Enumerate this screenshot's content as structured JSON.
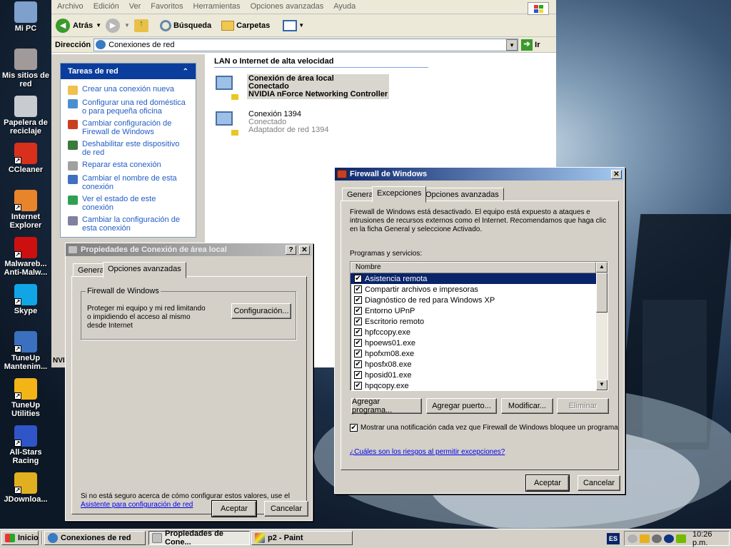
{
  "desktop": {
    "icons": [
      {
        "label": "Mi PC",
        "icon": "computer-icon",
        "color": "#7ea0cc",
        "shortcut": false
      },
      {
        "label": "Mis sitios de red",
        "icon": "network-places-icon",
        "color": "#a09a9a",
        "shortcut": false
      },
      {
        "label": "Papelera de reciclaje",
        "icon": "recycle-bin-icon",
        "color": "#c8ccd0",
        "shortcut": false
      },
      {
        "label": "CCleaner",
        "icon": "ccleaner-icon",
        "color": "#d8301c",
        "shortcut": true
      },
      {
        "label": "Internet Explorer",
        "icon": "firefox-icon",
        "color": "#e8842a",
        "shortcut": true
      },
      {
        "label": "Malwareb... Anti-Malw...",
        "icon": "malwarebytes-icon",
        "color": "#cc1010",
        "shortcut": true
      },
      {
        "label": "Skype",
        "icon": "skype-icon",
        "color": "#12a5e6",
        "shortcut": true
      },
      {
        "label": "TuneUp Mantenim...",
        "icon": "tuneup-maintenance-icon",
        "color": "#3b6fbf",
        "shortcut": true
      },
      {
        "label": "TuneUp Utilities",
        "icon": "tuneup-utilities-icon",
        "color": "#f2b417",
        "shortcut": true
      },
      {
        "label": "All-Stars Racing",
        "icon": "sonic-icon",
        "color": "#2f55c8",
        "shortcut": true
      },
      {
        "label": "JDownloa...",
        "icon": "jdownloader-icon",
        "color": "#e0b020",
        "shortcut": true
      }
    ]
  },
  "explorer": {
    "menu": [
      "Archivo",
      "Edición",
      "Ver",
      "Favoritos",
      "Herramientas",
      "Opciones avanzadas",
      "Ayuda"
    ],
    "toolbar": {
      "back": "Atrás",
      "search": "Búsqueda",
      "folders": "Carpetas"
    },
    "address": {
      "label": "Dirección",
      "value": "Conexiones de red",
      "go": "Ir"
    },
    "tasks": {
      "title": "Tareas de red",
      "items": [
        {
          "label": "Crear una conexión nueva",
          "icon": "new-connection-icon"
        },
        {
          "label": "Configurar una red doméstica o para pequeña oficina",
          "icon": "home-network-icon"
        },
        {
          "label": "Cambiar configuración de Firewall de Windows",
          "icon": "firewall-icon"
        },
        {
          "label": "Deshabilitar este dispositivo de red",
          "icon": "disable-device-icon"
        },
        {
          "label": "Reparar esta conexión",
          "icon": "repair-icon"
        },
        {
          "label": "Cambiar el nombre de esta conexión",
          "icon": "rename-icon"
        },
        {
          "label": "Ver el estado de este conexión",
          "icon": "status-icon"
        },
        {
          "label": "Cambiar la configuración de esta conexión",
          "icon": "settings-icon"
        }
      ]
    },
    "group_title": "LAN o Internet de alta velocidad",
    "connections": [
      {
        "name": "Conexión de área local",
        "status": "Conectado",
        "device": "NVIDIA nForce Networking Controller"
      },
      {
        "name": "Conexión 1394",
        "status": "Conectado",
        "device": "Adaptador de red 1394"
      }
    ],
    "status_fragment": "NVI"
  },
  "props": {
    "title": "Propiedades de Conexión de área local",
    "tabs": [
      "General",
      "Opciones avanzadas"
    ],
    "group_title": "Firewall de Windows",
    "group_text": "Proteger mi equipo y mi red limitando o impidiendo el acceso al mismo desde Internet",
    "config_button": "Configuración...",
    "footer_text": "Si no está seguro acerca de cómo configurar estos valores, use el",
    "footer_link": "Asistente para configuración de red",
    "ok": "Aceptar",
    "cancel": "Cancelar"
  },
  "firewall": {
    "title": "Firewall de Windows",
    "tabs": [
      "General",
      "Excepciones",
      "Opciones avanzadas"
    ],
    "info": "Firewall de Windows está desactivado. El equipo está expuesto a ataques e intrusiones de recursos externos como el Internet. Recomendamos que haga clic en la ficha General y seleccione Activado.",
    "list_label": "Programas y servicios:",
    "column": "Nombre",
    "programs": [
      "Asistencia remota",
      "Compartir archivos e impresoras",
      "Diagnóstico de red para Windows XP",
      "Entorno UPnP",
      "Escritorio remoto",
      "hpfccopy.exe",
      "hpoews01.exe",
      "hpofxm08.exe",
      "hposfx08.exe",
      "hposid01.exe",
      "hpqcopy.exe"
    ],
    "buttons": {
      "add_program": "Agregar programa...",
      "add_port": "Agregar puerto...",
      "modify": "Modificar...",
      "delete": "Eliminar"
    },
    "notify": "Mostrar una notificación cada vez que Firewall de Windows bloquee un programa",
    "risks_link": "¿Cuáles son los riesgos al permitir excepciones?",
    "ok": "Aceptar",
    "cancel": "Cancelar"
  },
  "taskbar": {
    "start": "Inicio",
    "items": [
      "Conexiones de red",
      "Propiedades de Cone...",
      "p2 - Paint"
    ],
    "language": "ES",
    "clock": "10:26 p.m."
  }
}
